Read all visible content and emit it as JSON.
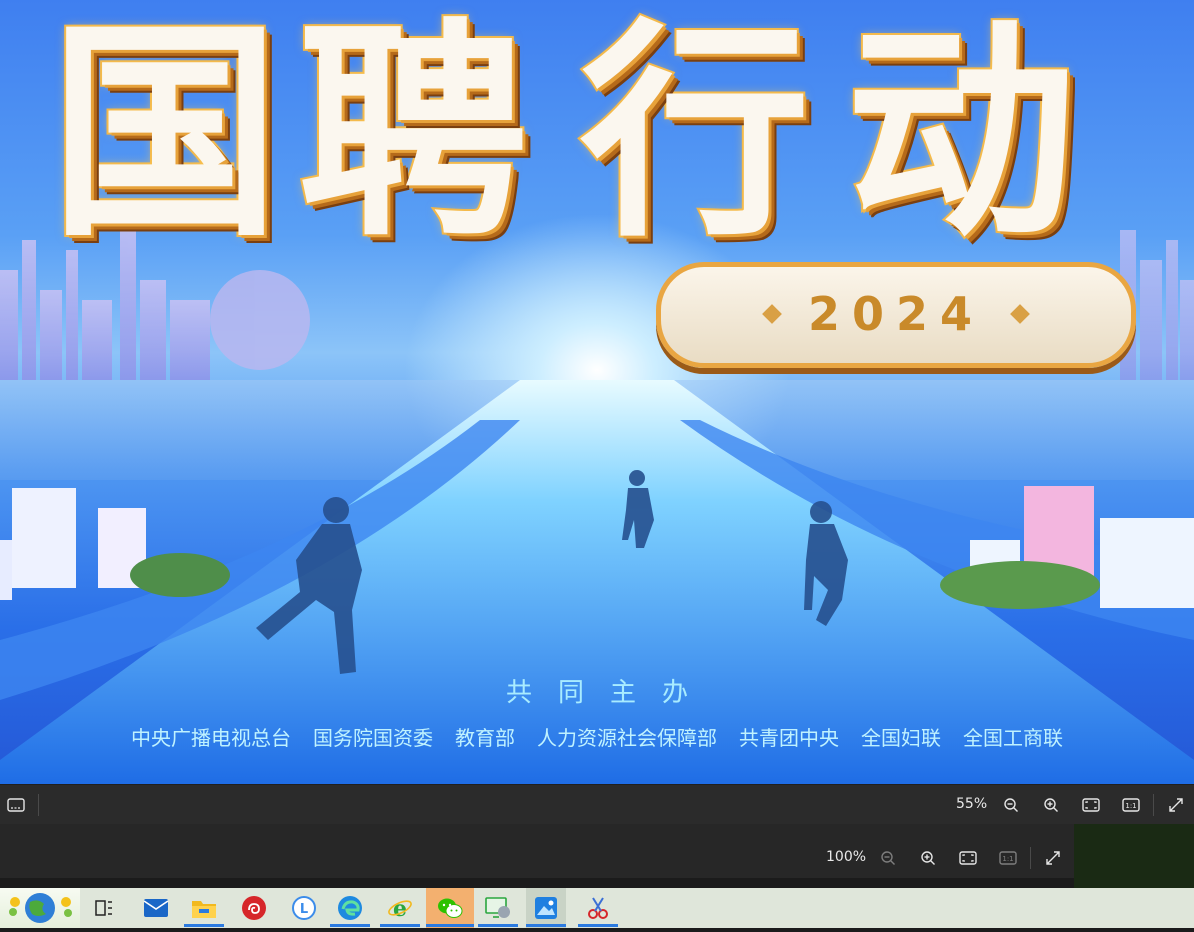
{
  "poster": {
    "title": [
      "国",
      "聘",
      "行",
      "动"
    ],
    "year": "2024",
    "host_title": "共同主办",
    "organizers": [
      "中央广播电视总台",
      "国务院国资委",
      "教育部",
      "人力资源社会保障部",
      "共青团中央",
      "全国妇联",
      "全国工商联"
    ]
  },
  "viewer_toolbar_top": {
    "zoom": "55%",
    "icons": [
      "filmstrip-icon",
      "zoom-out-icon",
      "zoom-in-icon",
      "fit-window-icon",
      "actual-size-icon",
      "fullscreen-icon"
    ]
  },
  "viewer_toolbar_bottom": {
    "zoom": "100%",
    "icons": [
      "zoom-out-icon",
      "zoom-in-icon",
      "fit-window-icon",
      "actual-size-icon",
      "fullscreen-icon"
    ]
  },
  "taskbar": {
    "items": [
      "start-button",
      "task-view",
      "mail",
      "file-explorer",
      "netease-music",
      "lark",
      "edge",
      "ie",
      "wechat",
      "remote-desktop",
      "photos",
      "snipping-tool"
    ]
  },
  "colors": {
    "toolbar_bg": "#2b2b2b",
    "taskbar_bg": "#dfe6da",
    "accent": "#2c7be0",
    "title_gold": "#e9a642"
  }
}
